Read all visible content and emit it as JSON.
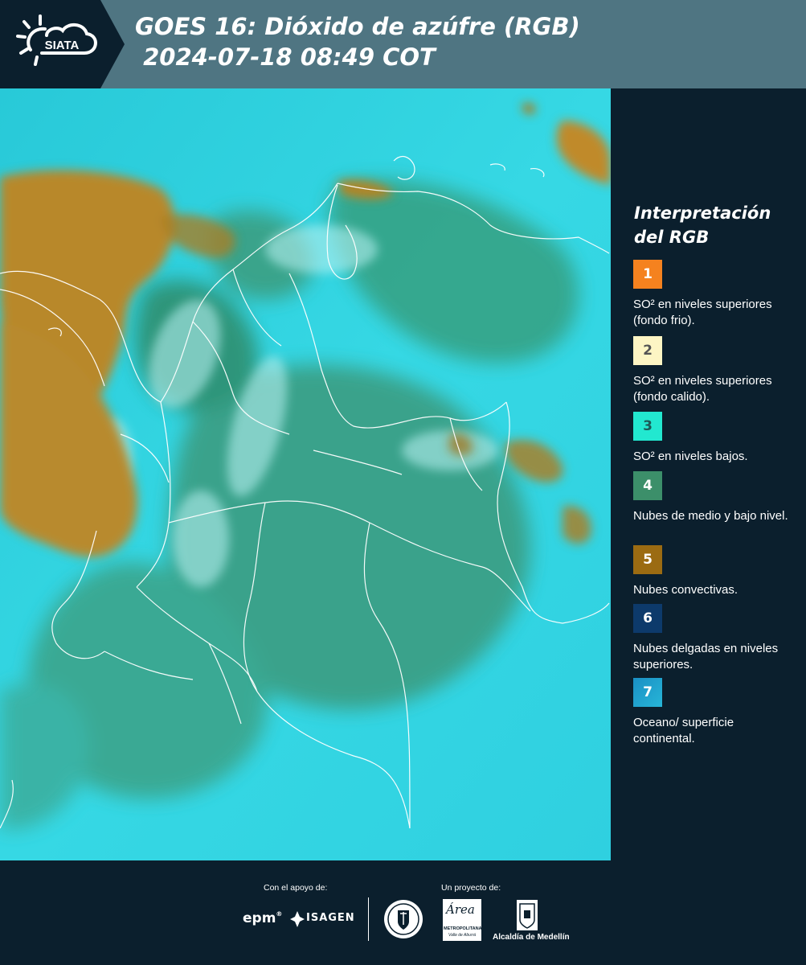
{
  "header": {
    "logo_text": "SIATA",
    "title_line1": "GOES 16: Dióxido de azúfre (RGB)",
    "title_line2": " 2024-07-18 08:49 COT"
  },
  "legend": {
    "title": "Interpretación del RGB",
    "items": [
      {
        "number": "1",
        "color": "#f5821f",
        "text_color": "#ffffff",
        "label": "SO² en niveles superiores (fondo frio)."
      },
      {
        "number": "2",
        "color": "#fdf5c4",
        "text_color": "#555555",
        "label": "SO² en niveles superiores (fondo calido)."
      },
      {
        "number": "3",
        "color": "#22e8d0",
        "text_color": "#1d5a57",
        "label": "SO² en niveles bajos."
      },
      {
        "number": "4",
        "color": "#3c8f6a",
        "text_color": "#ffffff",
        "label": "Nubes de medio y bajo nivel."
      },
      {
        "number": "5",
        "color": "#9b6b12",
        "text_color": "#ffffff",
        "label": "Nubes convectivas."
      },
      {
        "number": "6",
        "color": "#0d3a6b",
        "text_color": "#ffffff",
        "label": "Nubes delgadas en niveles superiores."
      },
      {
        "number": "7",
        "color": "#1a8fc4",
        "text_color": "#ffffff",
        "label": "Oceano/ superficie continental."
      }
    ]
  },
  "footer": {
    "support_label": "Con el apoyo de:",
    "project_label": "Un proyecto de:",
    "sponsor_epm": "epm",
    "sponsor_isagen": "ISAGEN",
    "area_logo_text": "Área",
    "area_sub1": "METROPOLITANA",
    "area_sub2": "Valle de Aburrá",
    "alcaldia": "Alcaldía de Medellín"
  },
  "colors": {
    "header_bg": "#4f7582",
    "panel_bg": "#0b1f2d",
    "ocean": "#2cd4e0",
    "clouds_warm": "#b88a2c",
    "land_green": "#2f8a6a"
  }
}
